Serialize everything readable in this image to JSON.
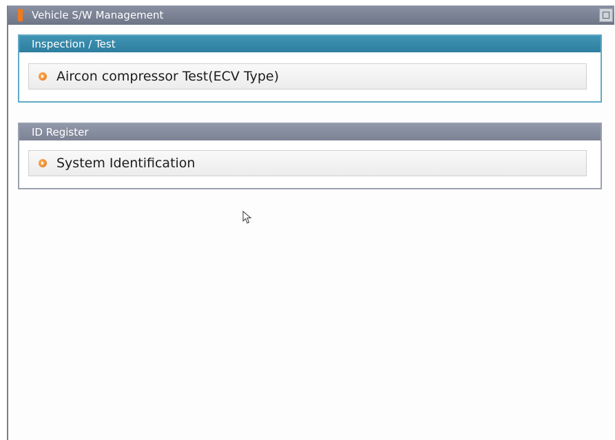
{
  "window": {
    "title": "Vehicle S/W Management"
  },
  "groups": [
    {
      "header": "Inspection / Test",
      "items": [
        {
          "label": "Aircon compressor Test(ECV Type)",
          "icon": "orange-arrow-bullet-icon"
        }
      ]
    },
    {
      "header": "ID Register",
      "items": [
        {
          "label": "System Identification",
          "icon": "orange-arrow-bullet-icon"
        }
      ]
    }
  ],
  "colors": {
    "title_bar": "#7a8194",
    "title_marker": "#f07a1c",
    "inspection_header": "#3688a9",
    "id_header": "#8a91a2",
    "bullet": "#f07a1c"
  }
}
